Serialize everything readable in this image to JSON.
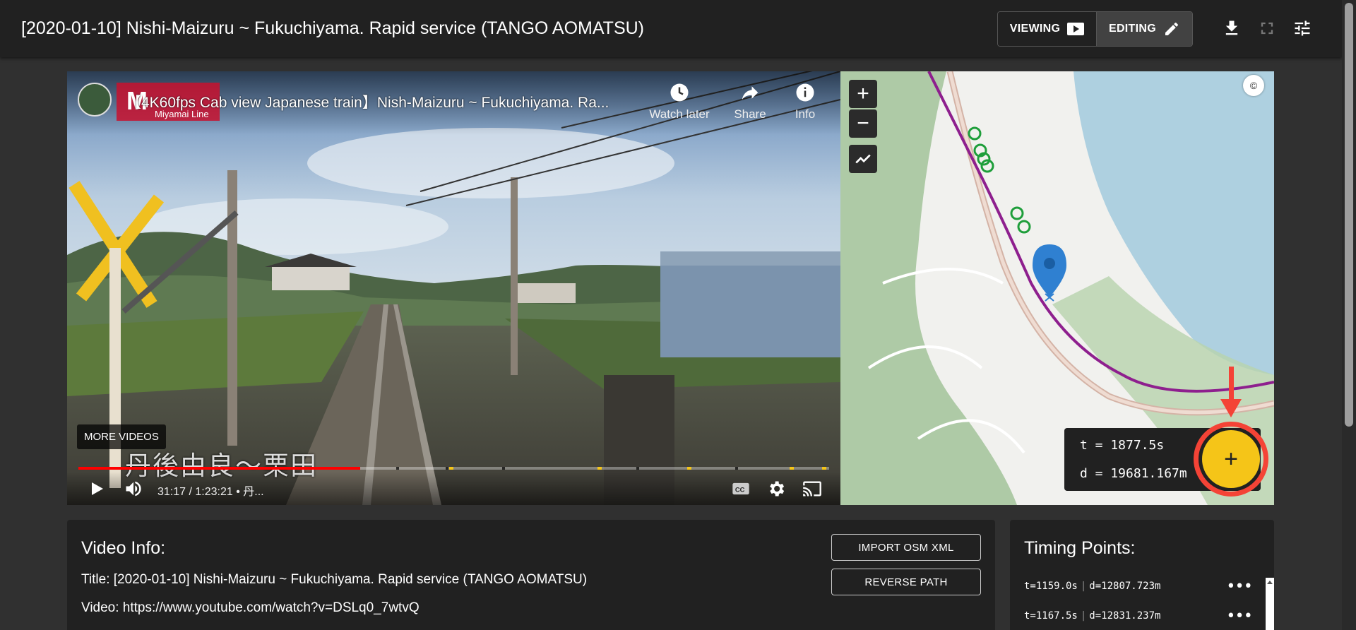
{
  "header": {
    "title": "[2020-01-10] Nishi-Maizuru ~ Fukuchiyama. Rapid service (TANGO AOMATSU)",
    "viewing_label": "VIEWING",
    "editing_label": "EDITING",
    "active_mode": "editing"
  },
  "video": {
    "title": "【4K60fps Cab view Japanese train】Nish-Maizuru ~ Fukuchiyama. Ra...",
    "logo_text": "M",
    "logo_subtitle": "Miyamai Line",
    "watch_later": "Watch later",
    "share": "Share",
    "info": "Info",
    "more_videos": "MORE VIDEOS",
    "caption": "丹後由良～栗田",
    "time": "31:17 / 1:23:21 • 丹...",
    "progress_fraction": 0.375
  },
  "map": {
    "zoom_in": "+",
    "zoom_out": "−",
    "attribution": "©",
    "readout": {
      "t": "t = 1877.5s",
      "d": "d = 19681.167m"
    },
    "add_button": "+",
    "route_color": "#8e1f8e",
    "marker_color": "#2f80d1",
    "timing_marker_color": "#1e9e3a",
    "accent_color": "#f44336"
  },
  "video_info": {
    "heading": "Video Info:",
    "title_line": "Title: [2020-01-10] Nishi-Maizuru ~ Fukuchiyama. Rapid service (TANGO AOMATSU)",
    "video_line": "Video: https://www.youtube.com/watch?v=DSLq0_7wtvQ",
    "import_button": "IMPORT OSM XML",
    "reverse_button": "REVERSE PATH"
  },
  "timing_points": {
    "heading": "Timing Points:",
    "rows": [
      {
        "t": "t=1159.0s",
        "sep": "|",
        "d": "d=12807.723m",
        "menu": "•••"
      },
      {
        "t": "t=1167.5s",
        "sep": "|",
        "d": "d=12831.237m",
        "menu": "•••"
      }
    ]
  }
}
